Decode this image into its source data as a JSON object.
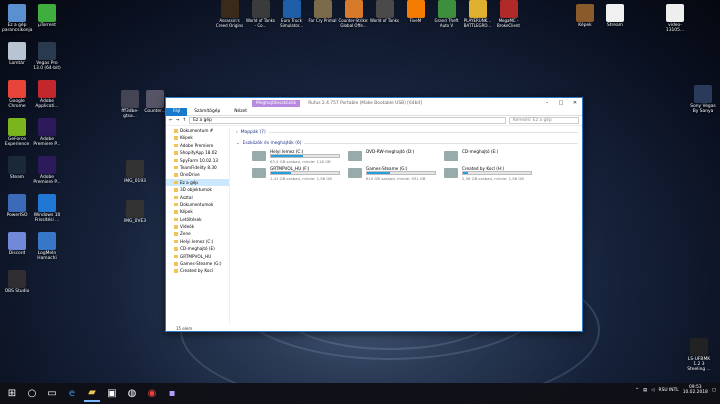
{
  "desktop_left": [
    {
      "label": "Ez a gép parancsikonja",
      "color": "#5a8fd0"
    },
    {
      "label": "µTorrent",
      "color": "#3fae3f"
    },
    {
      "label": "Lomtár",
      "color": "#b9c4d3"
    },
    {
      "label": "Vegas Pro 13.0 (64-bit)",
      "color": "#2a3a4e"
    },
    {
      "label": "Google Chrome",
      "color": "#e9443a"
    },
    {
      "label": "Adobe Applicati...",
      "color": "#c2272d"
    },
    {
      "label": "GeForce Experience",
      "color": "#7ab51d"
    },
    {
      "label": "Adobe Premiere P...",
      "color": "#2d1a5a"
    },
    {
      "label": "Steam",
      "color": "#1b2838"
    },
    {
      "label": "Adobe Premiere P...",
      "color": "#2d1a5a"
    },
    {
      "label": "PowerISO",
      "color": "#3b6ab8"
    },
    {
      "label": "Windows 10 Frissítési ...",
      "color": "#2178d4"
    },
    {
      "label": "Discord",
      "color": "#7289da"
    },
    {
      "label": "LogMeIn Hamachi",
      "color": "#3877c8"
    },
    {
      "label": "OBS Studio",
      "color": "#302e31"
    }
  ],
  "desktop_mid": [
    {
      "label": "fff3dbe-gtsa...",
      "color": "#445"
    },
    {
      "label": "Counter...",
      "color": "#556"
    },
    {
      "label": "IMG_0193",
      "color": "#333"
    },
    {
      "label": "IMG_0VE3",
      "color": "#333"
    }
  ],
  "desktop_top": [
    {
      "label": "Assassin's Creed Origins",
      "color": "#3a2a1a"
    },
    {
      "label": "World of Tanks - Co...",
      "color": "#3b3b3b"
    },
    {
      "label": "Euro Truck Simulator...",
      "color": "#1f5fa8"
    },
    {
      "label": "Far Cry Primal",
      "color": "#7a6b4a"
    },
    {
      "label": "Counter-Strike: Global Offe...",
      "color": "#d77a2a"
    },
    {
      "label": "World of Tanks",
      "color": "#4a4a4a"
    },
    {
      "label": "FiveM",
      "color": "#f57c00"
    },
    {
      "label": "Grand Theft Auto V",
      "color": "#3d8f3d"
    },
    {
      "label": "PLAYERUNK... BATTLEGRO...",
      "color": "#e0b030"
    },
    {
      "label": "MegaMC - BrokeClient",
      "color": "#b02a2a"
    }
  ],
  "desktop_right": [
    {
      "label": "Képek",
      "color": "#8a5a2a"
    },
    {
      "label": "Stream",
      "color": "#f0f0f0"
    },
    {
      "label": "video-13105...",
      "color": "#eee"
    },
    {
      "label": "Sony Vegas By Sanya",
      "color": "#2a3a5a"
    },
    {
      "label": "LS-UFBMK 1.2 3 Steeling ...",
      "color": "#222"
    }
  ],
  "explorer": {
    "context_tab": "Meghajtóeszközök",
    "path_title": "Rufus 2.4.757 Portable (Make Bootable USB) [64bit]",
    "nav_title": "Ez a gép",
    "controls": [
      "–",
      "□",
      "✕"
    ],
    "ribbon": [
      "Fájl",
      "Számítógép",
      "Nézet"
    ],
    "address": "Ez a gép",
    "search_placeholder": "Keresés: Ez a gép",
    "nav_items": [
      "Dokumentum #",
      "Képek",
      "Adobe Premiere",
      "ShopifyApp 18.02",
      "SpyFarm 10.02.13",
      "TeamFidelity 8.30",
      "OneDrive",
      "Ez a gép",
      "3D objektumok",
      "Asztal",
      "Dokumentumok",
      "Képek",
      "Letöltések",
      "Videók",
      "Zene",
      "Helyi lemez (C:)",
      "CD-meghajtó (E)",
      "GRTMPVOL_HU",
      "Games-Steame (G:)",
      "Created by Kocl"
    ],
    "selected_nav": 7,
    "group_folders": "Mappák (7)",
    "group_devices": "Eszközök és meghajtók (6)",
    "drives": [
      {
        "name": "Helyi lemez (C:)",
        "free": "63,4 GB szabad, minde: 118 GB",
        "pct": 47
      },
      {
        "name": "DVD-RW-meghajtó (D:)",
        "free": "",
        "pct": 0
      },
      {
        "name": "CD-meghajtó (E:)",
        "free": "",
        "pct": 0
      },
      {
        "name": "GRTMPVOL_HU (F:)",
        "free": "1,41 GB szabad, minde: 1,98 GB",
        "pct": 29
      },
      {
        "name": "Games-Steame (G:)",
        "free": "610 GB szabad, minde: 931 GB",
        "pct": 34
      },
      {
        "name": "Created by Kocl (H:)",
        "free": "2,56 GB szabad, minde: 1,98 GB",
        "pct": 8
      }
    ],
    "status": "15 elem"
  },
  "tray": {
    "lang": "RSU INTL",
    "time": "09:53",
    "date": "10.02.2018"
  }
}
